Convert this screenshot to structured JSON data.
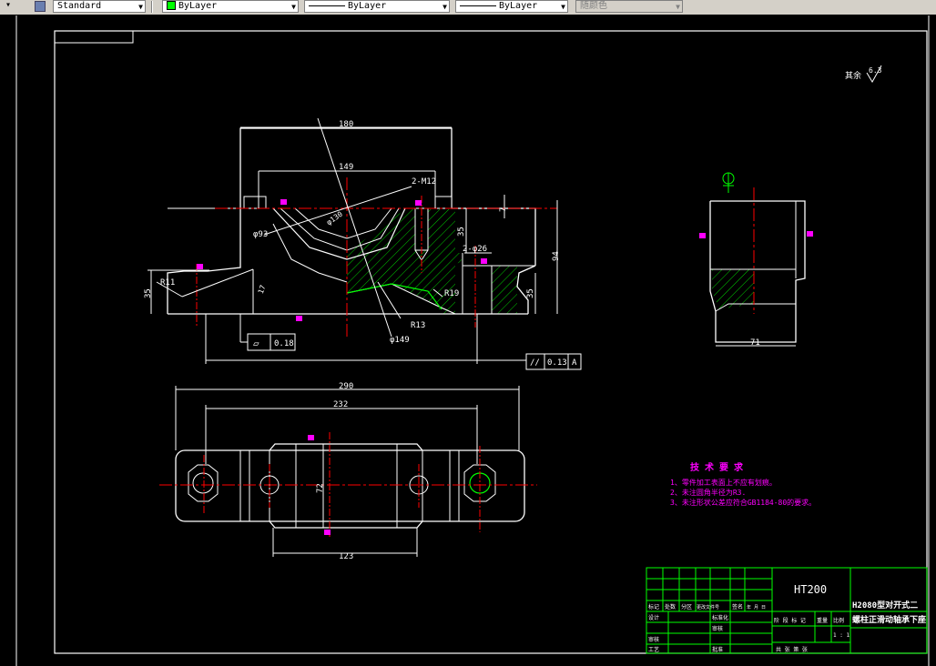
{
  "toolbar": {
    "text_style": "Standard",
    "layer": "ByLayer",
    "linetype": "ByLayer",
    "lineweight": "ByLayer",
    "plot_style": "随颜色"
  },
  "drawing": {
    "roughness_label": "其余",
    "roughness_value": "6.3",
    "dims": {
      "d180": "180",
      "d149": "149",
      "d2m12": "2-M12",
      "d7": "7",
      "d35a": "35",
      "d94": "94",
      "d2phi26": "2-φ26",
      "d35b": "35",
      "d35c": "35",
      "dR11": "R11",
      "d17": "17",
      "dphi93": "φ93",
      "dR19": "R19",
      "dR13": "R13",
      "dphi149": "φ149",
      "dphi130": "φ130",
      "d71": "71",
      "d290": "290",
      "d232": "232",
      "d72": "72",
      "d123": "123"
    },
    "tolerance1": {
      "symbol": "▱",
      "value": "0.18"
    },
    "tolerance2": {
      "symbol": "//",
      "value": "0.13",
      "datum": "A"
    },
    "tech": {
      "title": "技 术 要 求",
      "items": [
        "1、零件加工表面上不应有划痕。",
        "2、未注圆角半径为R3.",
        "3、未注形状公差应符合GB1184-80的要求。"
      ]
    },
    "title_block": {
      "material": "HT200",
      "name_line1": "H2080型对开式二",
      "name_line2": "螺柱正滑动轴承下座",
      "labels": {
        "mark": "标记",
        "count": "处数",
        "zone": "分区",
        "doc": "更改文件号",
        "sign": "签名",
        "date": "年 月 日",
        "design": "设计",
        "std": "标准化",
        "stage": "阶 段 标 记",
        "weight": "重量",
        "scale": "比例",
        "scale_val": "1 : 1",
        "review": "审核",
        "process": "工艺",
        "approve": "批准",
        "check": "审核",
        "total": "共  张  第  张"
      }
    }
  },
  "colors": {
    "background": "#000000",
    "outline": "#ffffff",
    "centerline": "#ff0000",
    "hatch": "#00ff00",
    "frame": "#00ff00",
    "marker": "#ff00ff",
    "text_magenta": "#ff00ff"
  }
}
